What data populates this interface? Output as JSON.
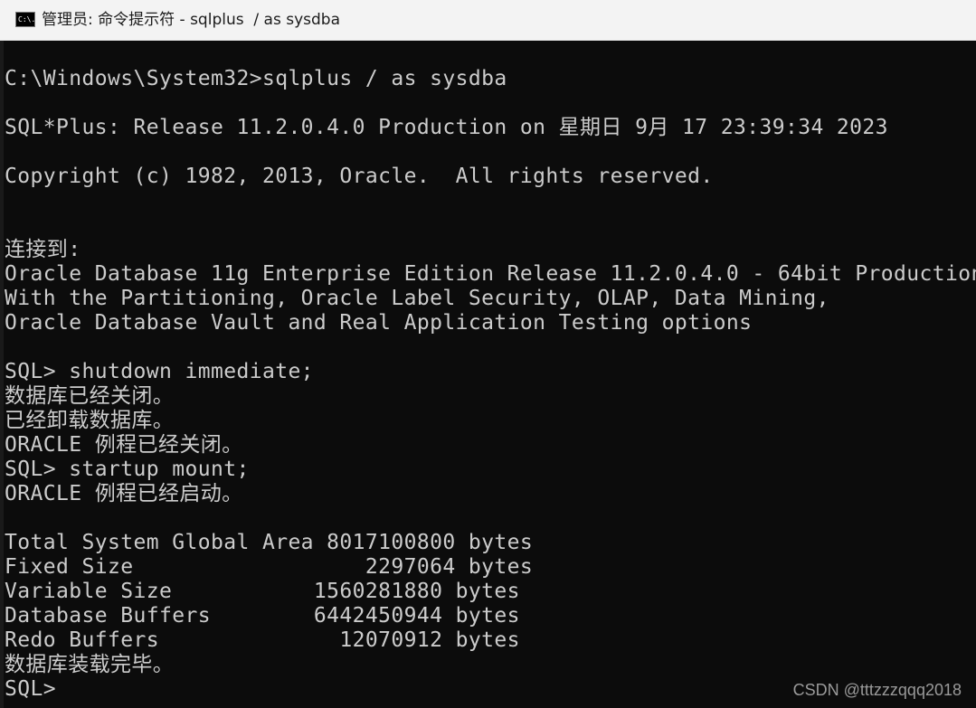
{
  "window": {
    "title": "管理员: 命令提示符 - sqlplus  / as sysdba",
    "icon": "cmd-icon",
    "icon_text": "C:\\."
  },
  "console": {
    "lines": [
      "C:\\Windows\\System32>sqlplus / as sysdba",
      "SQL*Plus: Release 11.2.0.4.0 Production on 星期日 9月 17 23:39:34 2023",
      "Copyright (c) 1982, 2013, Oracle.  All rights reserved.",
      "连接到:",
      "Oracle Database 11g Enterprise Edition Release 11.2.0.4.0 - 64bit Production",
      "With the Partitioning, Oracle Label Security, OLAP, Data Mining,",
      "Oracle Database Vault and Real Application Testing options",
      "SQL> shutdown immediate;",
      "数据库已经关闭。",
      "已经卸载数据库。",
      "ORACLE 例程已经关闭。",
      "SQL> startup mount;",
      "ORACLE 例程已经启动。",
      "Total System Global Area 8017100800 bytes",
      "Fixed Size                  2297064 bytes",
      "Variable Size           1560281880 bytes",
      "Database Buffers        6442450944 bytes",
      "Redo Buffers              12070912 bytes",
      "数据库装载完毕。",
      "SQL>"
    ]
  },
  "watermark": "CSDN @tttzzzqqq2018",
  "colors": {
    "console_bg": "#0c0c0c",
    "console_text": "#cccccc",
    "titlebar_bg": "#f3f3f3"
  }
}
